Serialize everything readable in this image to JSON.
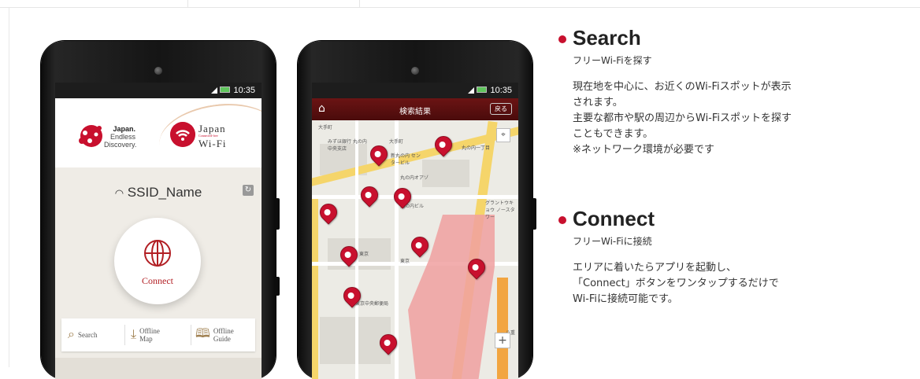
{
  "phone1": {
    "status": {
      "time": "10:35"
    },
    "brand_japan": {
      "title": "Japan.",
      "line2": "Endless",
      "line3": "Discovery."
    },
    "brand_wifi": {
      "title": "Japan",
      "sub": "Connected-free",
      "title2": "Wi-Fi"
    },
    "ssid": "SSID_Name",
    "connect_label": "Connect",
    "tabs": [
      {
        "label": "Search",
        "icon": "search-pin-icon"
      },
      {
        "label": "Offline Map",
        "icon": "download-tray-icon"
      },
      {
        "label": "Offline Guide",
        "icon": "open-book-icon"
      }
    ]
  },
  "phone2": {
    "status": {
      "time": "10:35"
    },
    "nav_title": "検索結果",
    "back_label": "戻る",
    "map_labels": [
      {
        "text": "大手町"
      },
      {
        "text": "みずほ銀行 丸の内中央支店"
      },
      {
        "text": "大手町"
      },
      {
        "text": "丸の内一丁目"
      },
      {
        "text": "新丸の内 センタービル"
      },
      {
        "text": "丸の内オアゾ"
      },
      {
        "text": "丸の内ビル"
      },
      {
        "text": "東京"
      },
      {
        "text": "東京"
      },
      {
        "text": "東京中央郵便局"
      },
      {
        "text": "グラントウキョウ ノースタワー"
      },
      {
        "text": "八重"
      }
    ]
  },
  "sections": [
    {
      "title": "Search",
      "subtitle": "フリーWi-Fiを探す",
      "lines": [
        "現在地を中心に、お近くのWi-Fiスポットが表示",
        "されます。",
        "主要な都市や駅の周辺からWi-Fiスポットを探す",
        "こともできます。",
        "※ネットワーク環境が必要です"
      ]
    },
    {
      "title": "Connect",
      "subtitle": "フリーWi-Fiに接続",
      "lines": [
        "エリアに着いたらアプリを起動し、",
        "「Connect」ボタンをワンタップするだけで",
        "Wi-Fiに接続可能です。"
      ]
    }
  ],
  "colors": {
    "accent": "#c8102e",
    "nav": "#5a1010"
  }
}
